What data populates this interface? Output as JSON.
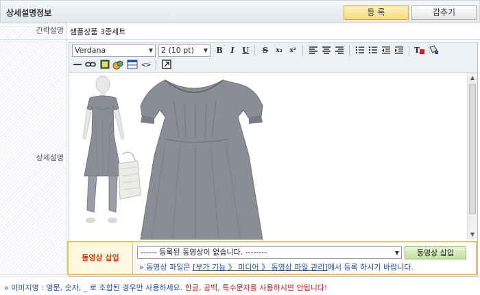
{
  "header": {
    "title": "상세설명정보",
    "register_label": "등 록",
    "hide_label": "감추기"
  },
  "form": {
    "short_label": "간략설명",
    "short_value": "샘플상품 3종세트",
    "detail_label": "상세설명"
  },
  "editor": {
    "font_family": "Verdana",
    "font_size": "2 (10 pt)",
    "toolbar": {
      "bold": "B",
      "italic": "I",
      "underline": "U",
      "strike": "S",
      "subscript": "x₂",
      "superscript": "x²"
    }
  },
  "video": {
    "label": "동영상 삽입",
    "select_value": "------ 등록된 동영상이 없습니다. --------",
    "insert_label": "동영상 삽입",
    "note_prefix": "» 동영상 파일은 ",
    "note_link": "[부가 기능 》 미디어 》 동영상 파일 관리]",
    "note_suffix": "에서 등록 하시기 바랍니다."
  },
  "footer": {
    "note_blue": "» 이미지명 : 영문, 숫자, _ 로 조합된 경우만 사용하세요.",
    "note_red": " 한글, 공백, 특수문자를 사용하시면 안됩니다!"
  },
  "colors": {
    "accent_red": "#d32020",
    "link_blue": "#1f4fa6",
    "garment_gray": "#8a8d94"
  }
}
